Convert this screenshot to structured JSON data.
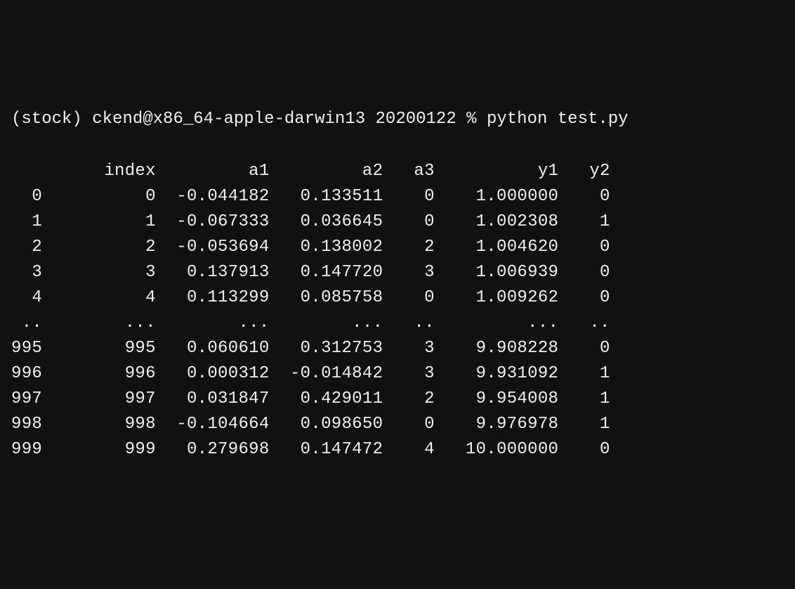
{
  "prompt": {
    "env": "(stock)",
    "user_host": "ckend@x86_64-apple-darwin13",
    "dir": "20200122",
    "symbol": "%",
    "command": "python test.py"
  },
  "headers": {
    "row_idx": "",
    "index": "index",
    "a1": "a1",
    "a2": "a2",
    "a3": "a3",
    "y1": "y1",
    "y2": "y2"
  },
  "rows": [
    {
      "ridx": "0",
      "index": "0",
      "a1": "-0.044182",
      "a2": "0.133511",
      "a3": "0",
      "y1": "1.000000",
      "y2": "0"
    },
    {
      "ridx": "1",
      "index": "1",
      "a1": "-0.067333",
      "a2": "0.036645",
      "a3": "0",
      "y1": "1.002308",
      "y2": "1"
    },
    {
      "ridx": "2",
      "index": "2",
      "a1": "-0.053694",
      "a2": "0.138002",
      "a3": "2",
      "y1": "1.004620",
      "y2": "0"
    },
    {
      "ridx": "3",
      "index": "3",
      "a1": "0.137913",
      "a2": "0.147720",
      "a3": "3",
      "y1": "1.006939",
      "y2": "0"
    },
    {
      "ridx": "4",
      "index": "4",
      "a1": "0.113299",
      "a2": "0.085758",
      "a3": "0",
      "y1": "1.009262",
      "y2": "0"
    }
  ],
  "ellipsis": {
    "ridx": "..",
    "index": "...",
    "a1": "...",
    "a2": "...",
    "a3": "..",
    "y1": "...",
    "y2": ".."
  },
  "rows2": [
    {
      "ridx": "995",
      "index": "995",
      "a1": "0.060610",
      "a2": "0.312753",
      "a3": "3",
      "y1": "9.908228",
      "y2": "0"
    },
    {
      "ridx": "996",
      "index": "996",
      "a1": "0.000312",
      "a2": "-0.014842",
      "a3": "3",
      "y1": "9.931092",
      "y2": "1"
    },
    {
      "ridx": "997",
      "index": "997",
      "a1": "0.031847",
      "a2": "0.429011",
      "a3": "2",
      "y1": "9.954008",
      "y2": "1"
    },
    {
      "ridx": "998",
      "index": "998",
      "a1": "-0.104664",
      "a2": "0.098650",
      "a3": "0",
      "y1": "9.976978",
      "y2": "1"
    },
    {
      "ridx": "999",
      "index": "999",
      "a1": "0.279698",
      "a2": "0.147472",
      "a3": "4",
      "y1": "10.000000",
      "y2": "0"
    }
  ]
}
